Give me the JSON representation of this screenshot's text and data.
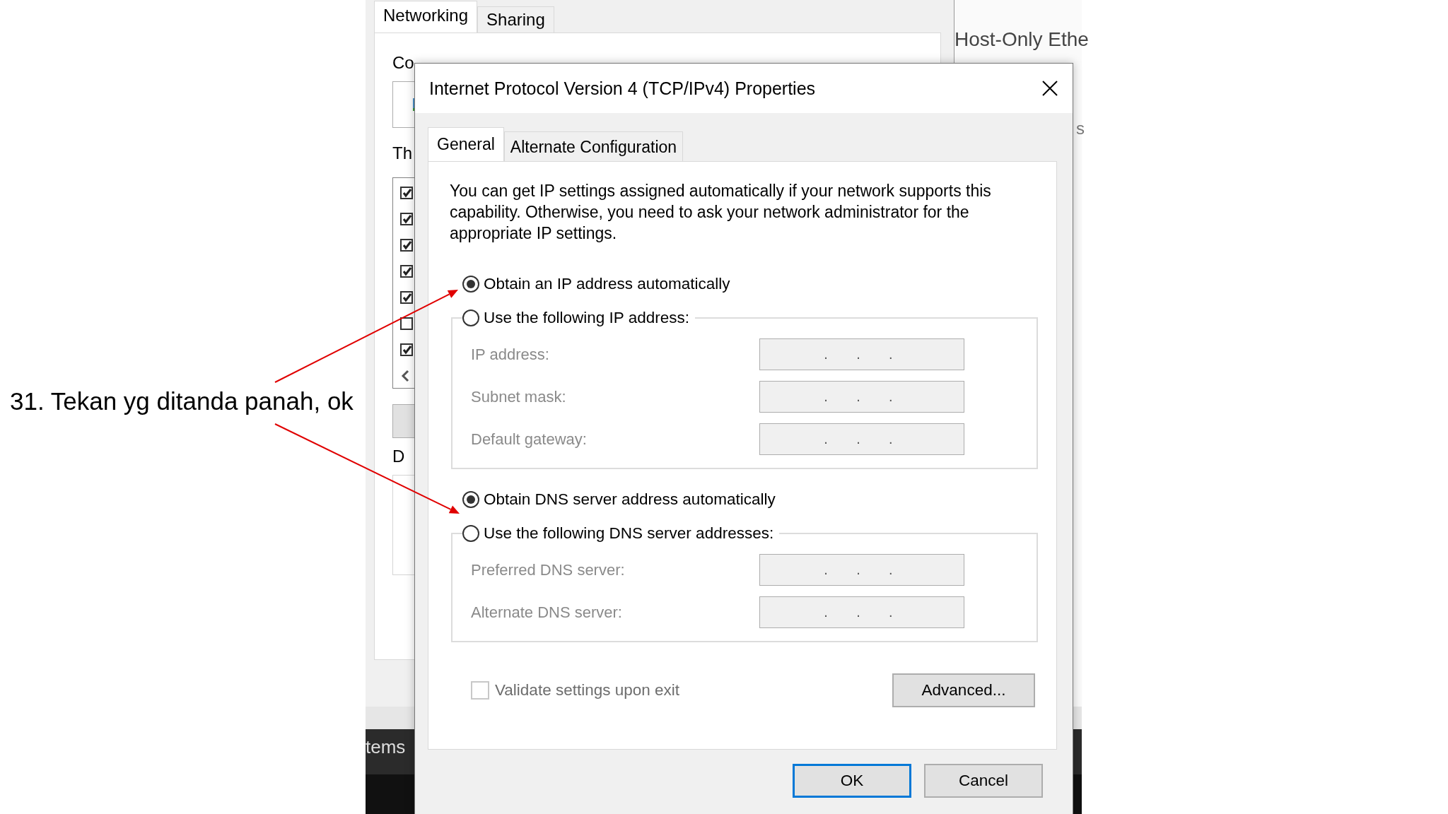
{
  "caption": "31. Tekan yg ditanda panah, ok",
  "background_window": {
    "tabs": [
      {
        "label": "Networking",
        "selected": true
      },
      {
        "label": "Sharing",
        "selected": false
      }
    ],
    "connect_label": "Co",
    "components_label": "Th",
    "components": [
      {
        "checked": true
      },
      {
        "checked": true
      },
      {
        "checked": true
      },
      {
        "checked": true
      },
      {
        "checked": true
      },
      {
        "checked": false
      },
      {
        "checked": true
      }
    ],
    "description_label": "D"
  },
  "side_text": "Host-Only Ethe",
  "side_letter": "s",
  "taskbar_text": "tems",
  "dialog": {
    "title": "Internet Protocol Version 4 (TCP/IPv4) Properties",
    "tabs": [
      {
        "label": "General",
        "selected": true
      },
      {
        "label": "Alternate Configuration",
        "selected": false
      }
    ],
    "description": "You can get IP settings assigned automatically if your network supports this capability. Otherwise, you need to ask your network administrator for the appropriate IP settings.",
    "sections": [
      {
        "options": [
          {
            "label": "Obtain an IP address automatically",
            "selected": true
          },
          {
            "label": "Use the following IP address:",
            "selected": false
          }
        ],
        "fields": [
          {
            "label": "IP address:",
            "disabled": true,
            "dots": [
              ".",
              ".",
              "."
            ]
          },
          {
            "label": "Subnet mask:",
            "disabled": true,
            "dots": [
              ".",
              ".",
              "."
            ]
          },
          {
            "label": "Default gateway:",
            "disabled": true,
            "dots": [
              ".",
              ".",
              "."
            ]
          }
        ]
      },
      {
        "options": [
          {
            "label": "Obtain DNS server address automatically",
            "selected": true
          },
          {
            "label": "Use the following DNS server addresses:",
            "selected": false
          }
        ],
        "fields": [
          {
            "label": "Preferred DNS server:",
            "disabled": true,
            "dots": [
              ".",
              ".",
              "."
            ]
          },
          {
            "label": "Alternate DNS server:",
            "disabled": true,
            "dots": [
              ".",
              ".",
              "."
            ]
          }
        ]
      }
    ],
    "validate": {
      "label": "Validate settings upon exit",
      "checked": false,
      "disabled": true
    },
    "advanced": "Advanced...",
    "buttons": [
      {
        "label": "OK",
        "default": true
      },
      {
        "label": "Cancel",
        "default": false
      }
    ]
  }
}
